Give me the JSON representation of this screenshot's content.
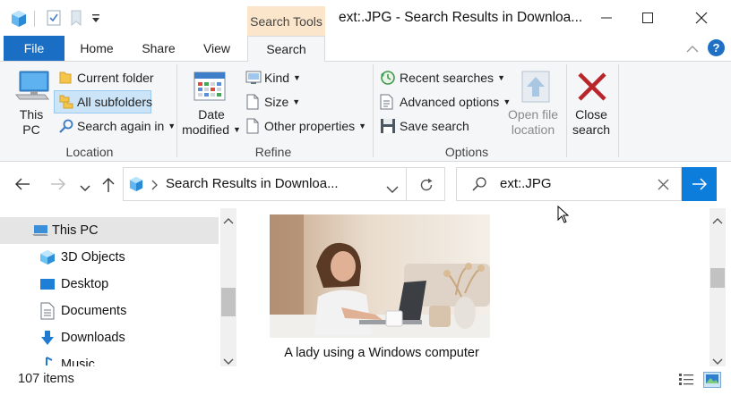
{
  "window": {
    "title": "ext:.JPG - Search Results in Downloa...",
    "context_tab_header": "Search Tools"
  },
  "ribbon": {
    "tabs": [
      "File",
      "Home",
      "Share",
      "View",
      "Search"
    ],
    "active_tab": "Search",
    "location": {
      "this_pc": [
        "This",
        "PC"
      ],
      "current_folder": "Current folder",
      "all_subfolders": "All subfolders",
      "search_again_in": "Search again in",
      "group_label": "Location"
    },
    "refine": {
      "date_modified": [
        "Date",
        "modified"
      ],
      "kind": "Kind",
      "size": "Size",
      "other_properties": "Other properties",
      "group_label": "Refine"
    },
    "options": {
      "recent_searches": "Recent searches",
      "advanced_options": "Advanced options",
      "save_search": "Save search",
      "open_file_location": [
        "Open file",
        "location"
      ],
      "close_search": [
        "Close",
        "search"
      ],
      "group_label": "Options"
    }
  },
  "address": {
    "path": "Search Results in Downloa...",
    "search_value": "ext:.JPG"
  },
  "nav": {
    "items": [
      "This PC",
      "3D Objects",
      "Desktop",
      "Documents",
      "Downloads",
      "Music"
    ],
    "selected": "This PC"
  },
  "content": {
    "items": [
      {
        "caption": "A lady using a Windows computer"
      }
    ]
  },
  "status": {
    "item_count": "107 items"
  },
  "colors": {
    "accent": "#0c7ddb",
    "file_tab": "#1a6fc4",
    "context_tab": "#fbe6cc",
    "selection": "#cce4f7"
  }
}
